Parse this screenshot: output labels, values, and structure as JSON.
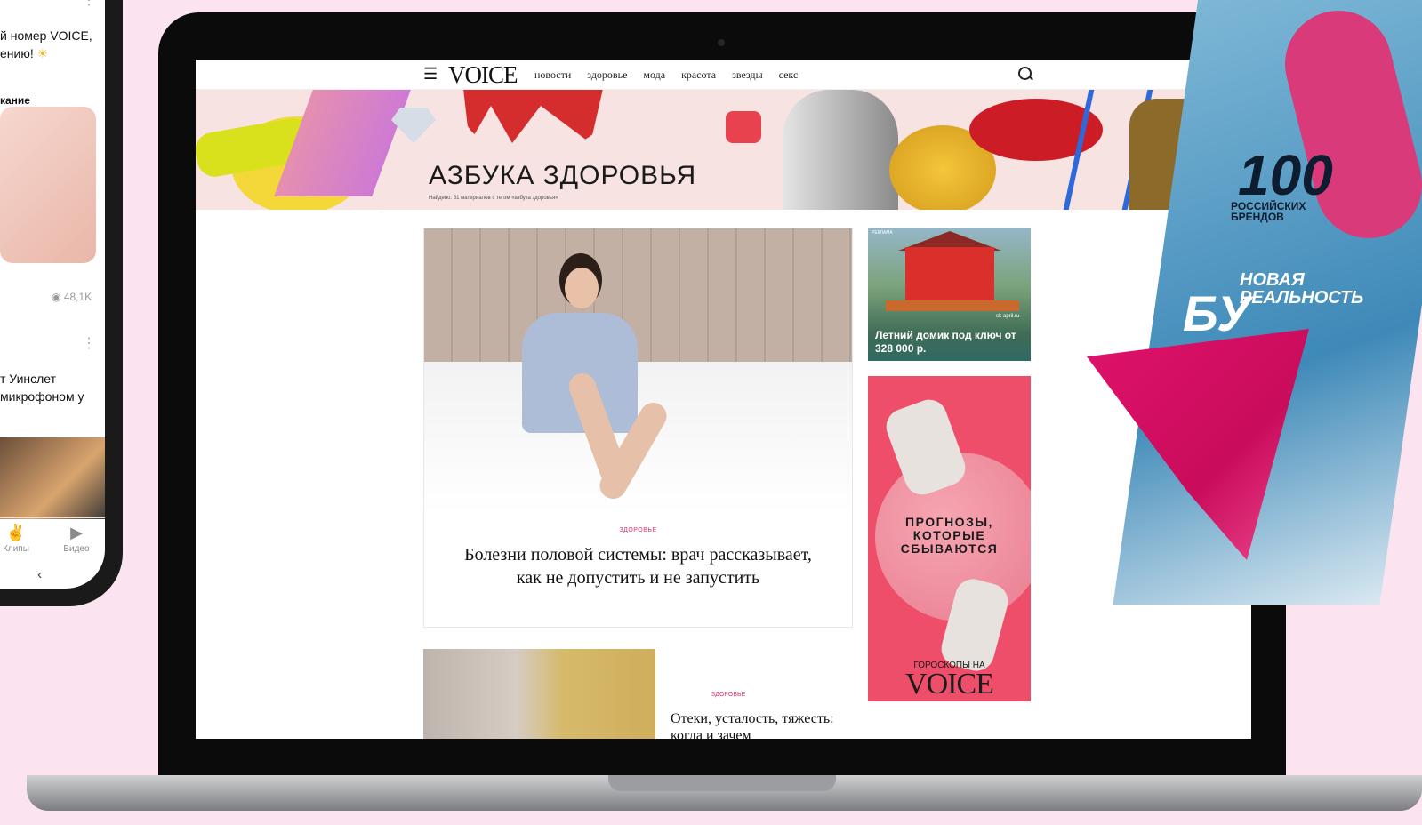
{
  "phone": {
    "text1": "й номер VOICE,",
    "text2": "ению!",
    "sun_emoji": "☀",
    "label1": "кание",
    "views": "48,1K",
    "text3": "т Уинслет",
    "text4": "микрофоном у",
    "nav": [
      {
        "label": "Клипы",
        "icon": "clips-icon"
      },
      {
        "label": "Видео",
        "icon": "video-icon"
      }
    ]
  },
  "site": {
    "logo": "VOICE",
    "nav": [
      "новости",
      "здоровье",
      "мода",
      "красота",
      "звезды",
      "секс"
    ],
    "banner": {
      "title": "АЗБУКА ЗДОРОВЬЯ",
      "subtitle": "Найдено: 31 материалов с тегом «азбука здоровья»"
    },
    "main_article": {
      "tag": "ЗДОРОВЬЕ",
      "title": "Болезни половой системы: врач рассказывает, как не допустить и не запустить"
    },
    "second_article": {
      "tag": "ЗДОРОВЬЕ",
      "title": "Отеки, усталость, тяжесть: когда и зачем"
    },
    "ad1": {
      "label": "РЕКЛАМА",
      "site": "sk-april.ru",
      "text": "Летний домик под ключ от 328 000 р."
    },
    "ad2": {
      "text": "ПРОГНОЗЫ, КОТОРЫЕ СБЫВАЮТСЯ",
      "footer": "ГОРОСКОПЫ НА",
      "logo": "VOICE"
    }
  },
  "magazine": {
    "number": "100",
    "subtitle": "РОССИЙСКИХ БРЕНДОВ",
    "line1": "НОВАЯ РЕАЛЬНОСТЬ",
    "line2": "БУ"
  },
  "colors": {
    "background": "#fbe4ef",
    "accent_tag": "#e0306f",
    "ad_pink": "#ef4e6a"
  }
}
